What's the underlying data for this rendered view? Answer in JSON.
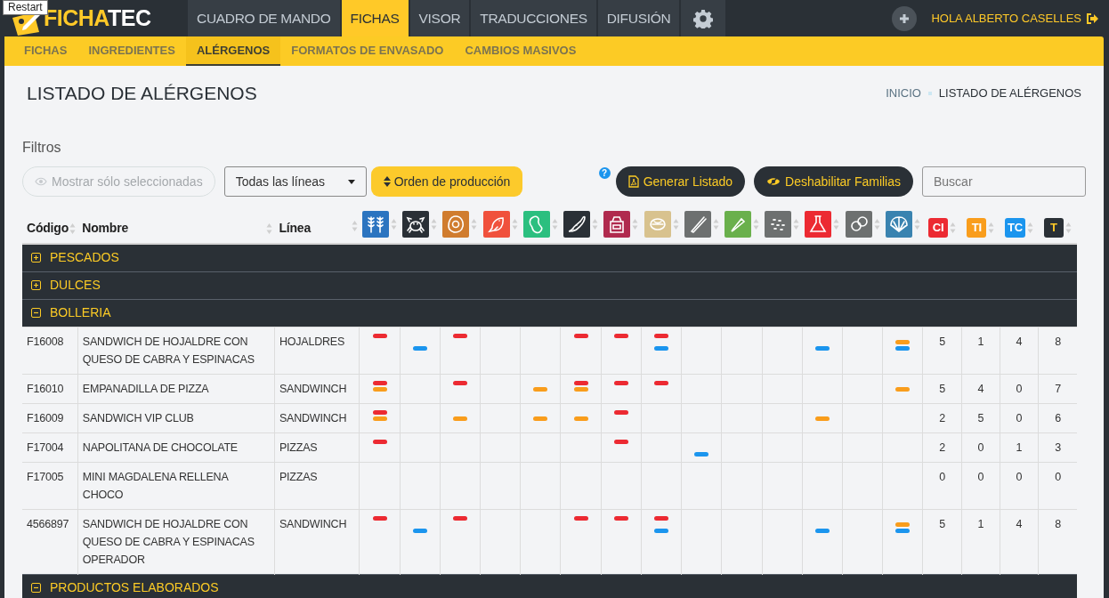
{
  "tooltip": "Restart",
  "logo": {
    "text_primary": "FICHA",
    "text_secondary": "TEC"
  },
  "main_tabs": [
    {
      "label": "CUADRO DE MANDO",
      "selected": false
    },
    {
      "label": "FICHAS",
      "selected": true
    },
    {
      "label": "VISOR",
      "selected": false
    },
    {
      "label": "TRADUCCIONES",
      "selected": false
    },
    {
      "label": "DIFUSIÓN",
      "selected": false
    },
    {
      "kind": "settings",
      "selected": false
    }
  ],
  "user": {
    "greeting": "HOLA ALBERTO CASELLES"
  },
  "sub_tabs": [
    {
      "label": "FICHAS",
      "selected": false
    },
    {
      "label": "INGREDIENTES",
      "selected": false
    },
    {
      "label": "ALÉRGENOS",
      "selected": true
    },
    {
      "label": "FORMATOS DE ENVASADO",
      "selected": false
    },
    {
      "label": "CAMBIOS MASIVOS",
      "selected": false
    }
  ],
  "page_title": "LISTADO DE ALÉRGENOS",
  "breadcrumb": [
    "INICIO",
    "LISTADO DE ALÉRGENOS"
  ],
  "filters": {
    "title": "Filtros",
    "show_selected": {
      "label": "Mostrar sólo seleccionadas",
      "disabled": true
    },
    "line_select": "Todas las líneas",
    "order_button": "Orden de producción",
    "help": "?",
    "generate_button": "Generar Listado",
    "disable_button": "Deshabilitar Familias",
    "search": {
      "placeholder": "Buscar"
    }
  },
  "table": {
    "columns": [
      "Código",
      "Nombre",
      "Línea"
    ],
    "allergen_columns": [
      {
        "kind": "wheat",
        "color": "#2b74c0"
      },
      {
        "kind": "crab",
        "color": "#2a3036"
      },
      {
        "kind": "egg",
        "color": "#d07c2e"
      },
      {
        "kind": "fish",
        "color": "#f0513c"
      },
      {
        "kind": "peanut",
        "color": "#2bbf7f"
      },
      {
        "kind": "soy",
        "color": "#2a3036"
      },
      {
        "kind": "milk",
        "color": "#b02a4e"
      },
      {
        "kind": "nut",
        "color": "#d8c28e"
      },
      {
        "kind": "celery",
        "color": "#6d7070"
      },
      {
        "kind": "mustard",
        "color": "#6ab04c"
      },
      {
        "kind": "sesame",
        "color": "#6d7070"
      },
      {
        "kind": "flask",
        "color": "#ec2a32"
      },
      {
        "kind": "lupin",
        "color": "#6d7070"
      },
      {
        "kind": "shell",
        "color": "#3a83b0"
      }
    ],
    "count_columns": [
      {
        "label": "CI",
        "color": "#ec2a32"
      },
      {
        "label": "TI",
        "color": "#f99d1c"
      },
      {
        "label": "TC",
        "color": "#1b95ee"
      },
      {
        "label": "T",
        "color": "#2a3036"
      }
    ],
    "groups": [
      {
        "name": "PESCADOS",
        "expanded": false
      },
      {
        "name": "DULCES",
        "expanded": false
      },
      {
        "name": "BOLLERIA",
        "expanded": true,
        "rows": [
          {
            "code": "F16008",
            "name": "SANDWICH DE HOJALDRE CON QUESO DE CABRA Y ESPINACAS",
            "line": "HOJALDRES",
            "allergens": [
              {
                "contains": true,
                "traces": false,
                "may_contain": false
              },
              {
                "contains": false,
                "traces": false,
                "may_contain": true
              },
              {
                "contains": true,
                "traces": false,
                "may_contain": false
              },
              {
                "contains": false,
                "traces": false,
                "may_contain": false
              },
              {
                "contains": false,
                "traces": false,
                "may_contain": false
              },
              {
                "contains": true,
                "traces": false,
                "may_contain": false
              },
              {
                "contains": true,
                "traces": false,
                "may_contain": false
              },
              {
                "contains": true,
                "traces": false,
                "may_contain": true
              },
              {
                "contains": false,
                "traces": false,
                "may_contain": false
              },
              {
                "contains": false,
                "traces": false,
                "may_contain": false
              },
              {
                "contains": false,
                "traces": false,
                "may_contain": false
              },
              {
                "contains": false,
                "traces": false,
                "may_contain": true
              },
              {
                "contains": false,
                "traces": false,
                "may_contain": false
              },
              {
                "contains": false,
                "traces": true,
                "may_contain": true
              }
            ],
            "counts": [
              "5",
              "1",
              "4",
              "8"
            ]
          },
          {
            "code": "F16010",
            "name": "EMPANADILLA DE PIZZA",
            "line": "SANDWINCH",
            "allergens": [
              {
                "contains": true,
                "traces": true,
                "may_contain": false
              },
              {
                "contains": false,
                "traces": false,
                "may_contain": false
              },
              {
                "contains": true,
                "traces": false,
                "may_contain": false
              },
              {
                "contains": false,
                "traces": false,
                "may_contain": false
              },
              {
                "contains": false,
                "traces": true,
                "may_contain": false
              },
              {
                "contains": true,
                "traces": true,
                "may_contain": false
              },
              {
                "contains": true,
                "traces": false,
                "may_contain": false
              },
              {
                "contains": true,
                "traces": false,
                "may_contain": false
              },
              {
                "contains": false,
                "traces": false,
                "may_contain": false
              },
              {
                "contains": false,
                "traces": false,
                "may_contain": false
              },
              {
                "contains": false,
                "traces": false,
                "may_contain": false
              },
              {
                "contains": false,
                "traces": false,
                "may_contain": false
              },
              {
                "contains": false,
                "traces": false,
                "may_contain": false
              },
              {
                "contains": false,
                "traces": true,
                "may_contain": false
              }
            ],
            "counts": [
              "5",
              "4",
              "0",
              "7"
            ]
          },
          {
            "code": "F16009",
            "name": "SANDWICH VIP CLUB",
            "line": "SANDWINCH",
            "allergens": [
              {
                "contains": true,
                "traces": true,
                "may_contain": false
              },
              {
                "contains": false,
                "traces": false,
                "may_contain": false
              },
              {
                "contains": false,
                "traces": true,
                "may_contain": false
              },
              {
                "contains": false,
                "traces": false,
                "may_contain": false
              },
              {
                "contains": false,
                "traces": true,
                "may_contain": false
              },
              {
                "contains": false,
                "traces": true,
                "may_contain": false
              },
              {
                "contains": true,
                "traces": false,
                "may_contain": false
              },
              {
                "contains": false,
                "traces": false,
                "may_contain": false
              },
              {
                "contains": false,
                "traces": false,
                "may_contain": false
              },
              {
                "contains": false,
                "traces": false,
                "may_contain": false
              },
              {
                "contains": false,
                "traces": false,
                "may_contain": false
              },
              {
                "contains": false,
                "traces": true,
                "may_contain": false
              },
              {
                "contains": false,
                "traces": false,
                "may_contain": false
              },
              {
                "contains": false,
                "traces": false,
                "may_contain": false
              }
            ],
            "counts": [
              "2",
              "5",
              "0",
              "6"
            ]
          },
          {
            "code": "F17004",
            "name": "NAPOLITANA DE CHOCOLATE",
            "line": "PIZZAS",
            "allergens": [
              {
                "contains": true,
                "traces": false,
                "may_contain": false
              },
              {
                "contains": false,
                "traces": false,
                "may_contain": false
              },
              {
                "contains": false,
                "traces": false,
                "may_contain": false
              },
              {
                "contains": false,
                "traces": false,
                "may_contain": false
              },
              {
                "contains": false,
                "traces": false,
                "may_contain": false
              },
              {
                "contains": false,
                "traces": false,
                "may_contain": false
              },
              {
                "contains": true,
                "traces": false,
                "may_contain": false
              },
              {
                "contains": false,
                "traces": false,
                "may_contain": false
              },
              {
                "contains": false,
                "traces": false,
                "may_contain": true
              },
              {
                "contains": false,
                "traces": false,
                "may_contain": false
              },
              {
                "contains": false,
                "traces": false,
                "may_contain": false
              },
              {
                "contains": false,
                "traces": false,
                "may_contain": false
              },
              {
                "contains": false,
                "traces": false,
                "may_contain": false
              },
              {
                "contains": false,
                "traces": false,
                "may_contain": false
              }
            ],
            "counts": [
              "2",
              "0",
              "1",
              "3"
            ]
          },
          {
            "code": "F17005",
            "name": "MINI MAGDALENA RELLENA CHOCO",
            "line": "PIZZAS",
            "allergens": [
              {
                "contains": false,
                "traces": false,
                "may_contain": false
              },
              {
                "contains": false,
                "traces": false,
                "may_contain": false
              },
              {
                "contains": false,
                "traces": false,
                "may_contain": false
              },
              {
                "contains": false,
                "traces": false,
                "may_contain": false
              },
              {
                "contains": false,
                "traces": false,
                "may_contain": false
              },
              {
                "contains": false,
                "traces": false,
                "may_contain": false
              },
              {
                "contains": false,
                "traces": false,
                "may_contain": false
              },
              {
                "contains": false,
                "traces": false,
                "may_contain": false
              },
              {
                "contains": false,
                "traces": false,
                "may_contain": false
              },
              {
                "contains": false,
                "traces": false,
                "may_contain": false
              },
              {
                "contains": false,
                "traces": false,
                "may_contain": false
              },
              {
                "contains": false,
                "traces": false,
                "may_contain": false
              },
              {
                "contains": false,
                "traces": false,
                "may_contain": false
              },
              {
                "contains": false,
                "traces": false,
                "may_contain": false
              }
            ],
            "counts": [
              "0",
              "0",
              "0",
              "0"
            ]
          },
          {
            "code": "4566897",
            "name": "SANDWICH DE HOJALDRE CON QUESO DE CABRA Y ESPINACAS OPERADOR",
            "line": "SANDWINCH",
            "allergens": [
              {
                "contains": true,
                "traces": false,
                "may_contain": false
              },
              {
                "contains": false,
                "traces": false,
                "may_contain": true
              },
              {
                "contains": true,
                "traces": false,
                "may_contain": false
              },
              {
                "contains": false,
                "traces": false,
                "may_contain": false
              },
              {
                "contains": false,
                "traces": false,
                "may_contain": false
              },
              {
                "contains": true,
                "traces": false,
                "may_contain": false
              },
              {
                "contains": true,
                "traces": false,
                "may_contain": false
              },
              {
                "contains": true,
                "traces": false,
                "may_contain": true
              },
              {
                "contains": false,
                "traces": false,
                "may_contain": false
              },
              {
                "contains": false,
                "traces": false,
                "may_contain": false
              },
              {
                "contains": false,
                "traces": false,
                "may_contain": false
              },
              {
                "contains": false,
                "traces": false,
                "may_contain": true
              },
              {
                "contains": false,
                "traces": false,
                "may_contain": false
              },
              {
                "contains": false,
                "traces": true,
                "may_contain": true
              }
            ],
            "counts": [
              "5",
              "1",
              "4",
              "8"
            ]
          }
        ]
      },
      {
        "name": "PRODUCTOS ELABORADOS",
        "expanded": true
      }
    ]
  }
}
